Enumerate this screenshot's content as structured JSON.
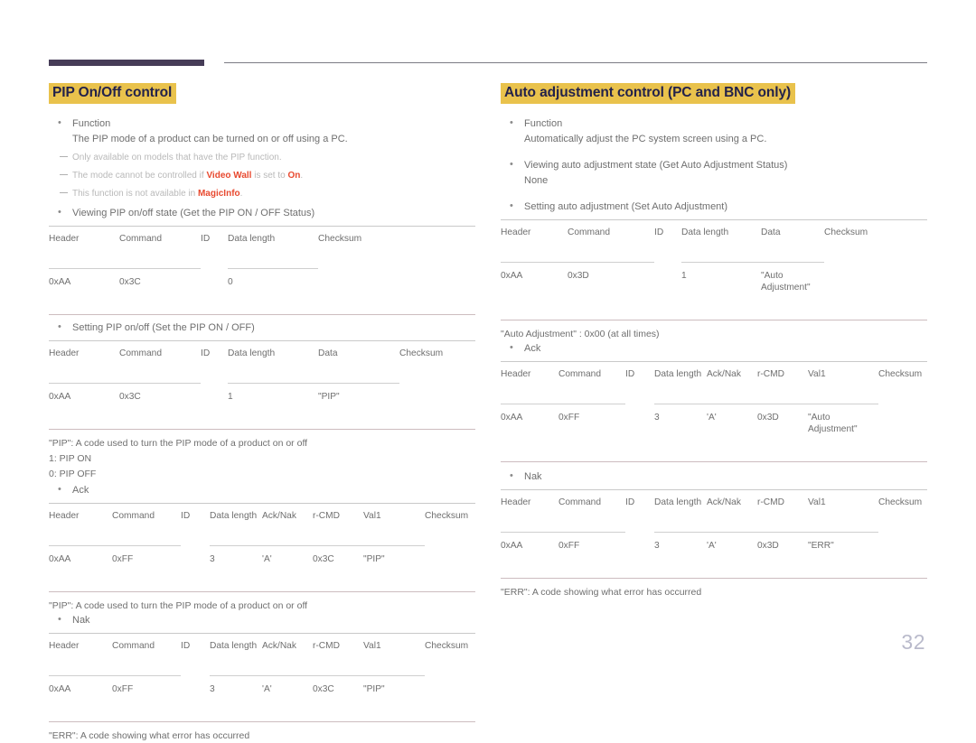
{
  "page": {
    "number": "32"
  },
  "left": {
    "title": "PIP On/Off control",
    "bullets": {
      "function_label": "Function",
      "function_text": "The PIP mode of a product can be turned on or off using a PC.",
      "viewing_label": "Viewing PIP on/off state (Get the PIP ON / OFF Status)",
      "setting_label": "Setting PIP on/off (Set the PIP ON / OFF)",
      "ack_label": "Ack",
      "nak_label": "Nak"
    },
    "notes": [
      {
        "pre": "Only available on models that have the PIP function.",
        "bold1": "",
        "mid": "",
        "bold2": "",
        "post": ""
      },
      {
        "pre": "The mode cannot be controlled if ",
        "bold1": "Video Wall",
        "mid": " is set to ",
        "bold2": "On",
        "post": "."
      },
      {
        "pre": "This function is not available in ",
        "bold1": "MagicInfo",
        "mid": "",
        "bold2": "",
        "post": "."
      }
    ],
    "table_get": {
      "headers": [
        "Header",
        "Command",
        "ID",
        "Data length",
        "Checksum"
      ],
      "row": [
        "0xAA",
        "0x3C",
        "",
        "0",
        ""
      ]
    },
    "table_set": {
      "headers": [
        "Header",
        "Command",
        "ID",
        "Data length",
        "Data",
        "Checksum"
      ],
      "row": [
        "0xAA",
        "0x3C",
        "",
        "1",
        "\"PIP\"",
        ""
      ]
    },
    "captions": {
      "pip_code": "\"PIP\": A code used to turn the PIP mode of a product on or off",
      "pip_on": "1: PIP ON",
      "pip_off": "0: PIP OFF",
      "pip_code2": "\"PIP\": A code used to turn the PIP mode of a product on or off",
      "err_code": "\"ERR\": A code showing what error has occurred"
    },
    "table_ack": {
      "headers": [
        "Header",
        "Command",
        "ID",
        "Data length",
        "Ack/Nak",
        "r-CMD",
        "Val1",
        "Checksum"
      ],
      "row": [
        "0xAA",
        "0xFF",
        "",
        "3",
        "'A'",
        "0x3C",
        "\"PIP\"",
        ""
      ]
    },
    "table_nak": {
      "headers": [
        "Header",
        "Command",
        "ID",
        "Data length",
        "Ack/Nak",
        "r-CMD",
        "Val1",
        "Checksum"
      ],
      "row": [
        "0xAA",
        "0xFF",
        "",
        "3",
        "'A'",
        "0x3C",
        "\"PIP\"",
        ""
      ]
    }
  },
  "right": {
    "title": "Auto adjustment control (PC and BNC only)",
    "bullets": {
      "function_label": "Function",
      "function_text": "Automatically adjust the PC system screen using a PC.",
      "viewing_label": "Viewing auto adjustment state (Get Auto Adjustment Status)",
      "viewing_value": "None",
      "setting_label": "Setting auto adjustment (Set Auto Adjustment)",
      "ack_label": "Ack",
      "nak_label": "Nak"
    },
    "table_set": {
      "headers": [
        "Header",
        "Command",
        "ID",
        "Data length",
        "Data",
        "Checksum"
      ],
      "row": [
        "0xAA",
        "0x3D",
        "",
        "1",
        "\"Auto Adjustment\"",
        ""
      ]
    },
    "captions": {
      "auto_adj": "\"Auto Adjustment\" : 0x00 (at all times)",
      "err_code": "\"ERR\": A code showing what error has occurred"
    },
    "table_ack": {
      "headers": [
        "Header",
        "Command",
        "ID",
        "Data length",
        "Ack/Nak",
        "r-CMD",
        "Val1",
        "Checksum"
      ],
      "row": [
        "0xAA",
        "0xFF",
        "",
        "3",
        "'A'",
        "0x3D",
        "\"Auto Adjustment\"",
        ""
      ]
    },
    "table_nak": {
      "headers": [
        "Header",
        "Command",
        "ID",
        "Data length",
        "Ack/Nak",
        "r-CMD",
        "Val1",
        "Checksum"
      ],
      "row": [
        "0xAA",
        "0xFF",
        "",
        "3",
        "'A'",
        "0x3D",
        "\"ERR\"",
        ""
      ]
    }
  }
}
